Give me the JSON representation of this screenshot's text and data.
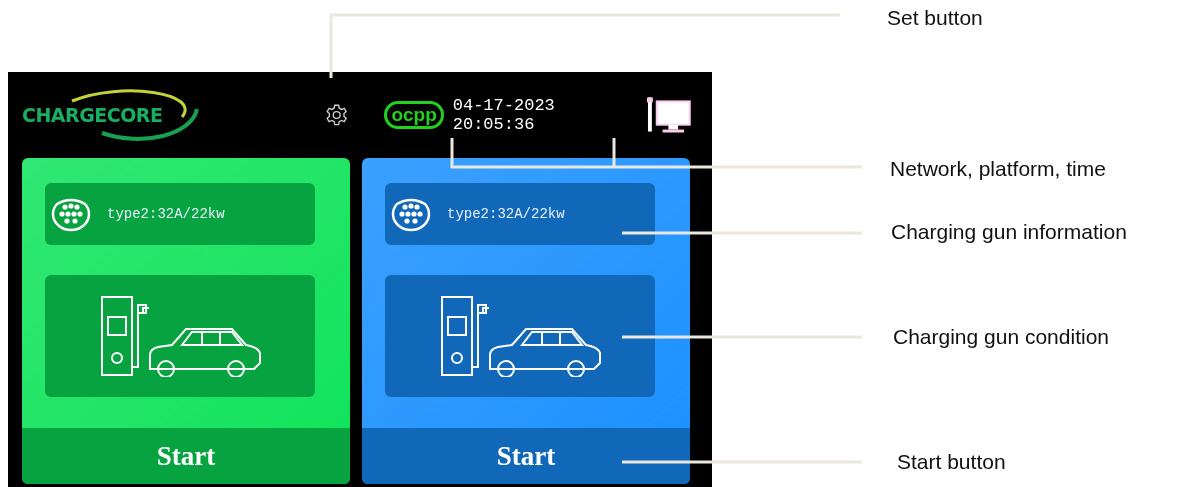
{
  "screen": {
    "logo": "CHARGECORE",
    "protocol_badge": "ocpp",
    "datetime": "04-17-2023 20:05:36",
    "guns": [
      {
        "color": "#0be35a",
        "connector_info": "type2:32A/22kw",
        "start_button": "Start"
      },
      {
        "color": "#1890ff",
        "connector_info": "type2:32A/22kw",
        "start_button": "Start"
      }
    ]
  },
  "callouts": [
    {
      "label": "Set button"
    },
    {
      "label": "Network, platform, time"
    },
    {
      "label": "Charging gun information"
    },
    {
      "label": "Charging gun condition"
    },
    {
      "label": "Start button"
    }
  ]
}
